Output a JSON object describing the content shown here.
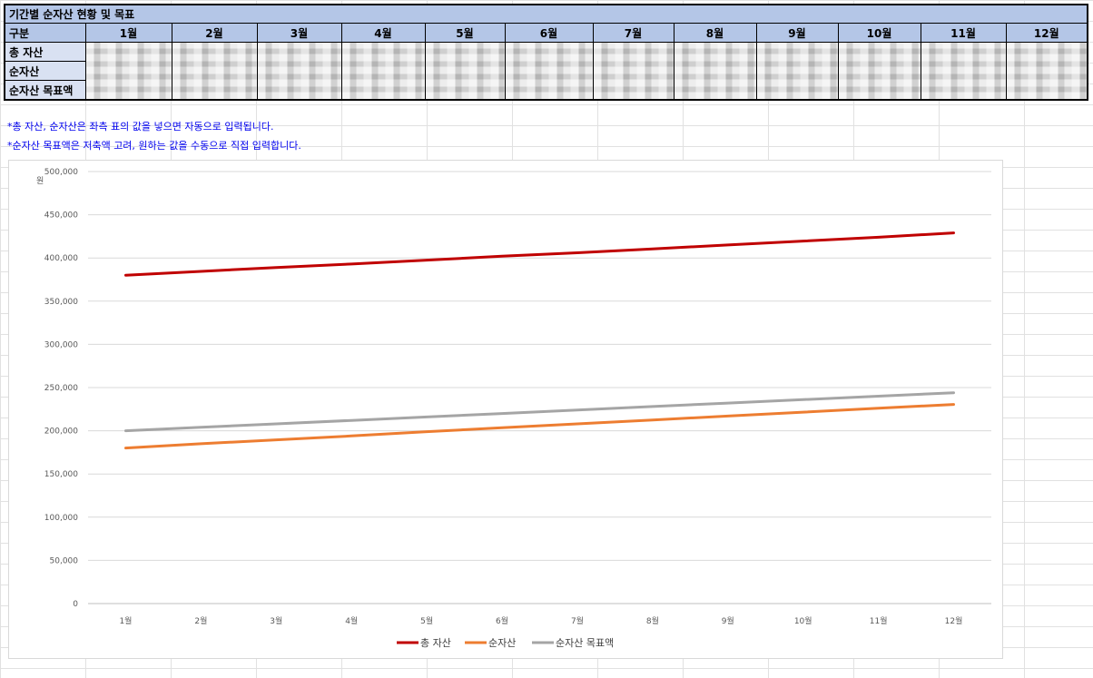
{
  "table": {
    "title": "기간별 순자산 현황 및 목표",
    "header_label": "구분",
    "months": [
      "1월",
      "2월",
      "3월",
      "4월",
      "5월",
      "6월",
      "7월",
      "8월",
      "9월",
      "10월",
      "11월",
      "12월"
    ],
    "rows": [
      "총 자산",
      "순자산",
      "순자산 목표액"
    ]
  },
  "notes": [
    "*총 자산, 순자산은 좌측 표의 값을 넣으면 자동으로 입력됩니다.",
    "*순자산 목표액은 저축액 고려, 원하는 값을 수동으로 직접 입력합니다."
  ],
  "chart_data": {
    "type": "line",
    "ylabel": "원",
    "ylim": [
      0,
      500000
    ],
    "yticks": [
      0,
      50000,
      100000,
      150000,
      200000,
      250000,
      300000,
      350000,
      400000,
      450000,
      500000
    ],
    "ytick_labels": [
      "0",
      "50,000",
      "100,000",
      "150,000",
      "200,000",
      "250,000",
      "300,000",
      "350,000",
      "400,000",
      "450,000",
      "500,000"
    ],
    "grid": true,
    "legend": "bottom",
    "categories": [
      "1월",
      "2월",
      "3월",
      "4월",
      "5월",
      "6월",
      "7월",
      "8월",
      "9월",
      "10월",
      "11월",
      "12월"
    ],
    "series": [
      {
        "name": "총 자산",
        "color": "#c00000",
        "values": [
          380000,
          384500,
          389000,
          393000,
          397500,
          402000,
          406000,
          410500,
          415000,
          419500,
          424000,
          429000
        ]
      },
      {
        "name": "순자산",
        "color": "#ed7d31",
        "values": [
          180000,
          185000,
          189500,
          194000,
          199000,
          203500,
          208000,
          212500,
          217000,
          221500,
          226000,
          230500
        ]
      },
      {
        "name": "순자산 목표액",
        "color": "#a5a5a5",
        "values": [
          200000,
          204000,
          208000,
          212000,
          216000,
          220000,
          224000,
          228000,
          232000,
          236000,
          240000,
          244000
        ]
      }
    ]
  }
}
